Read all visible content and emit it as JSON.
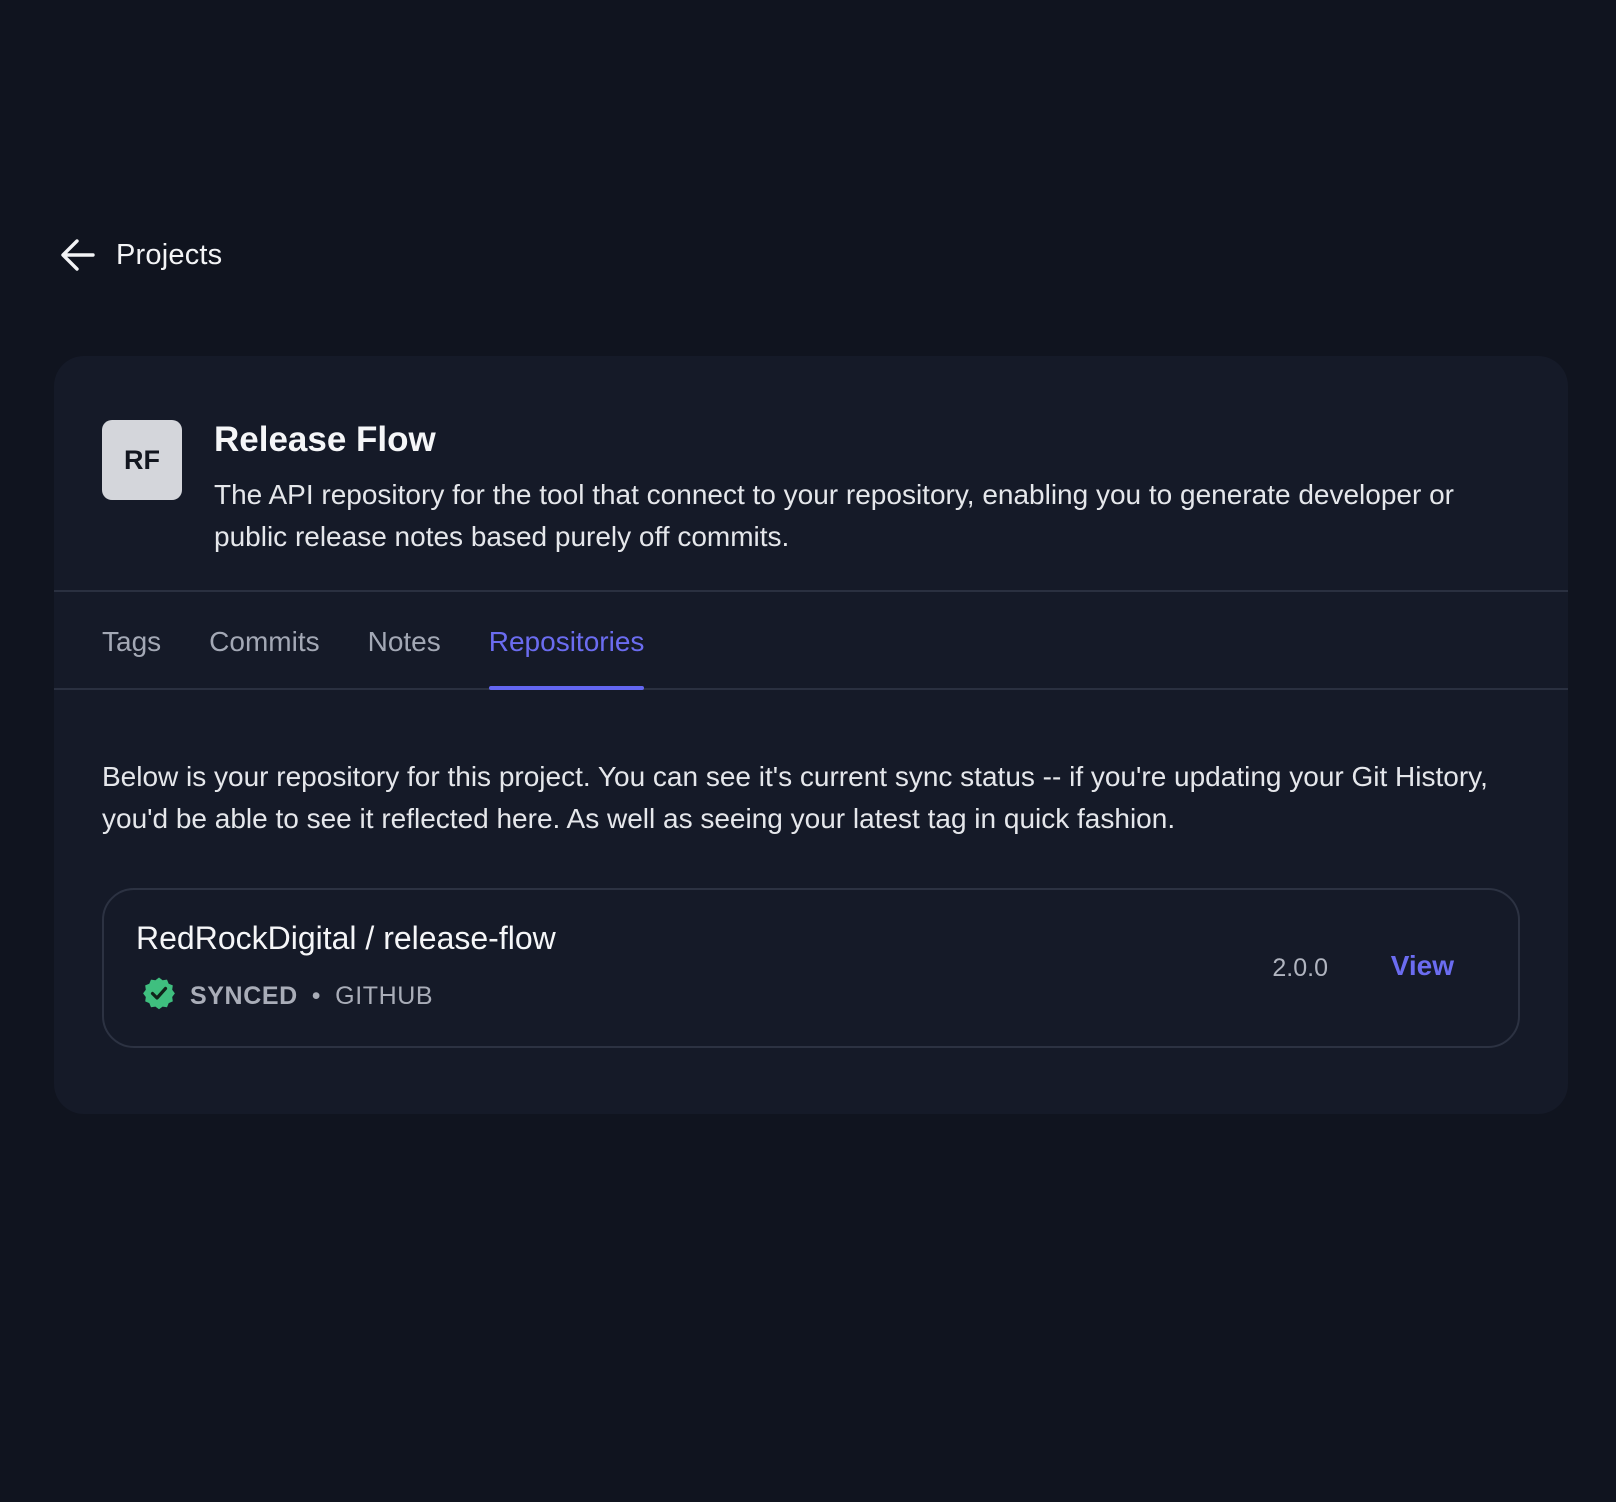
{
  "nav": {
    "back_label": "Projects",
    "back_icon": "arrow-left-icon"
  },
  "project": {
    "initials": "RF",
    "title": "Release Flow",
    "description": "The API repository for the tool that connect to your repository, enabling you to generate developer or public release notes based purely off commits."
  },
  "tabs": [
    {
      "label": "Tags",
      "active": false
    },
    {
      "label": "Commits",
      "active": false
    },
    {
      "label": "Notes",
      "active": false
    },
    {
      "label": "Repositories",
      "active": true
    }
  ],
  "repositories_tab": {
    "intro": "Below is your repository for this project. You can see it's current sync status -- if you're updating your Git History, you'd be able to see it reflected here. As well as seeing your latest tag in quick fashion.",
    "repository": {
      "name": "RedRockDigital / release-flow",
      "status": "SYNCED",
      "separator": "•",
      "provider": "GITHUB",
      "status_icon": "check-badge-icon",
      "latest_tag": "2.0.0",
      "view_label": "View"
    }
  },
  "colors": {
    "background": "#10141f",
    "card": "#151a28",
    "accent": "#6366f1",
    "synced": "#3fbf7f"
  }
}
